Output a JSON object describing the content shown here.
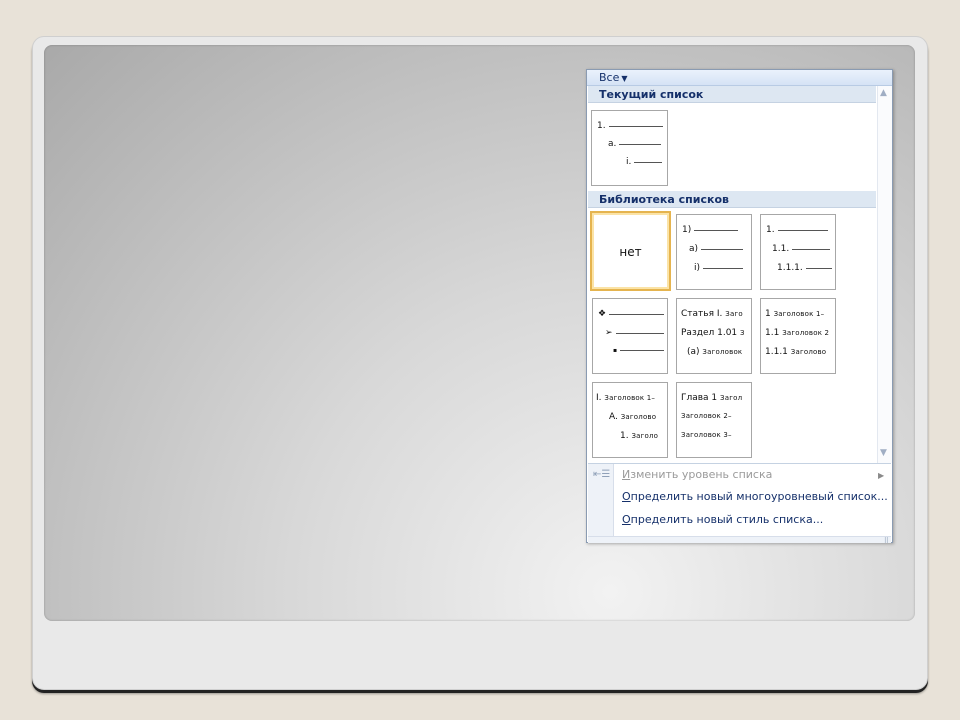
{
  "filter": {
    "label": "Все",
    "arrow": "▼"
  },
  "sections": {
    "current": "Текущий список",
    "library": "Библиотека списков"
  },
  "current_list": {
    "rows": [
      {
        "label": "1."
      },
      {
        "label": "a."
      },
      {
        "label": "i."
      }
    ]
  },
  "library": {
    "none_label": "нет",
    "tile2": [
      {
        "label": "1)"
      },
      {
        "label": "a)"
      },
      {
        "label": "i)"
      }
    ],
    "tile3": [
      {
        "label": "1."
      },
      {
        "label": "1.1."
      },
      {
        "label": "1.1.1."
      }
    ],
    "tile4": [
      {
        "label": "❖"
      },
      {
        "label": "➢"
      },
      {
        "label": "▪"
      }
    ],
    "tile5": [
      {
        "big": "Статья I.",
        "small": "Заго"
      },
      {
        "big": "Раздел 1.01",
        "small": "З"
      },
      {
        "big": "(a)",
        "small": "Заголовок"
      }
    ],
    "tile6": [
      {
        "big": "1",
        "small": "Заголовок 1–"
      },
      {
        "big": "1.1",
        "small": "Заголовок 2"
      },
      {
        "big": "1.1.1",
        "small": "Заголово"
      }
    ],
    "tile7": [
      {
        "big": "I.",
        "small": "Заголовок 1–"
      },
      {
        "big": "A.",
        "small": "Заголово"
      },
      {
        "big": "1.",
        "small": "Заголо"
      }
    ],
    "tile8": [
      {
        "big": "Глава 1",
        "small": "Загол"
      },
      {
        "big": "",
        "small": "Заголовок 2–"
      },
      {
        "big": "",
        "small": "Заголовок 3–"
      }
    ]
  },
  "menu": {
    "change_level": {
      "first": "И",
      "rest": "зменить уровень списка"
    },
    "define_multilevel": {
      "first": "О",
      "rest": "пределить новый многоуровневый список..."
    },
    "define_style": {
      "first": "О",
      "rest": "пределить новый стиль списка..."
    }
  },
  "icons": {
    "scroll_up": "▲",
    "scroll_down": "▼",
    "submenu": "▶",
    "level": "⇤☰",
    "grip": "⠿"
  }
}
